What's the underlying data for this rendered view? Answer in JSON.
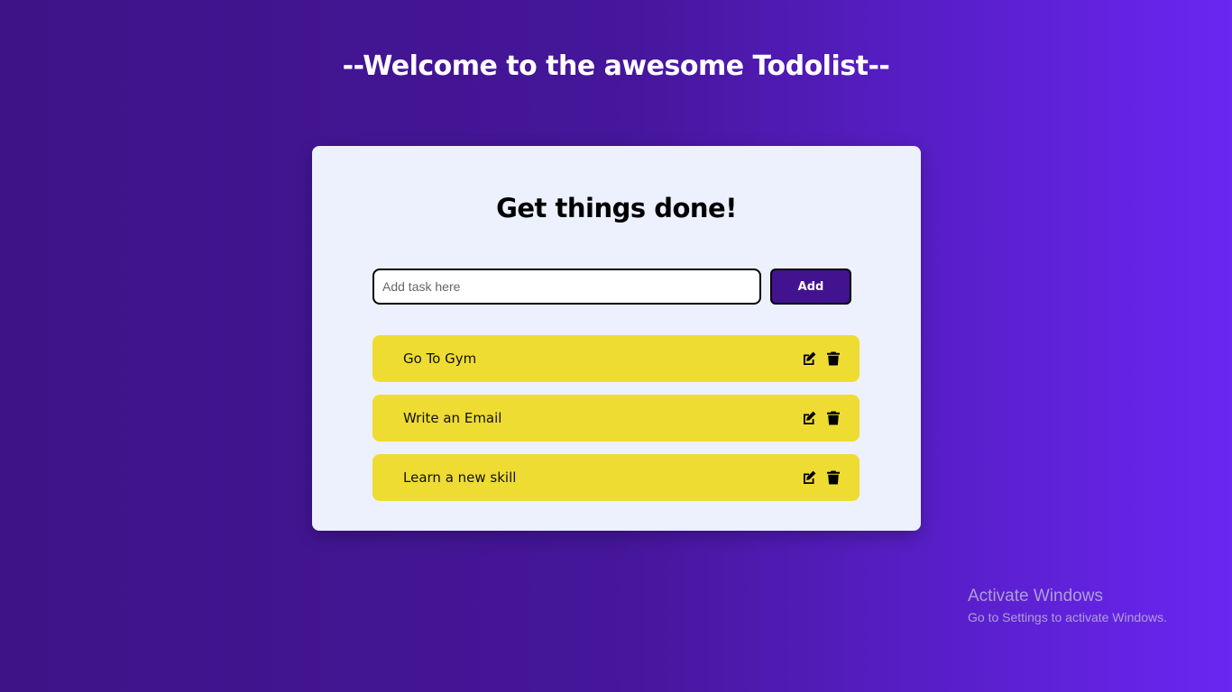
{
  "header": {
    "title": "--Welcome to the awesome Todolist--"
  },
  "card": {
    "title": "Get things done!",
    "input": {
      "value": "",
      "placeholder": "Add task here"
    },
    "add_label": "Add"
  },
  "tasks": [
    {
      "label": "Go To Gym",
      "actions": [
        "edit-icon",
        "trash-icon"
      ]
    },
    {
      "label": "Write an Email",
      "actions": [
        "edit-icon",
        "trash-icon"
      ]
    },
    {
      "label": "Learn a new skill",
      "actions": [
        "edit-icon",
        "trash-icon"
      ]
    }
  ],
  "watermark": {
    "title": "Activate Windows",
    "subtitle": "Go to Settings to activate Windows."
  },
  "colors": {
    "background_start": "#3e1387",
    "background_end": "#6a26f2",
    "card": "#edf1fd",
    "task": "#efdc32",
    "add_button": "#42138e"
  }
}
